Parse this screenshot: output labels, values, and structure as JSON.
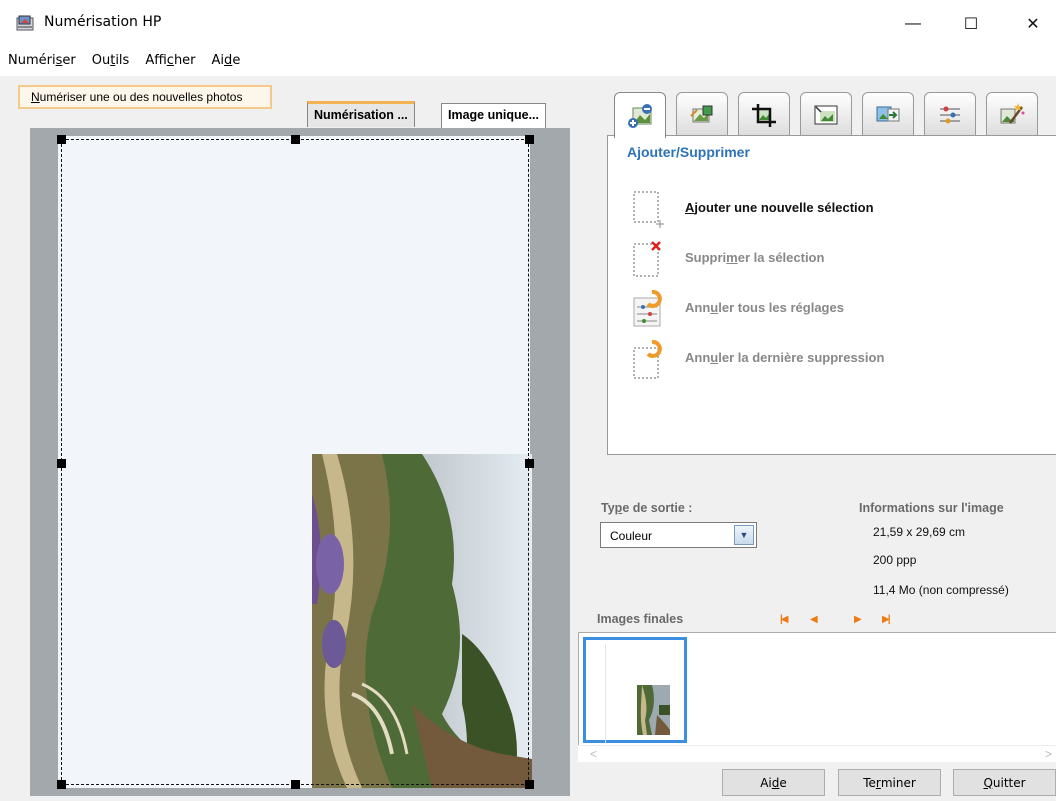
{
  "window": {
    "title": "Numérisation HP",
    "controls": {
      "minimize": "—",
      "maximize": "☐",
      "close": "✕"
    }
  },
  "menu": {
    "items": [
      {
        "pre": "Numéri",
        "key": "s",
        "post": "er"
      },
      {
        "pre": "Ou",
        "key": "t",
        "post": "ils"
      },
      {
        "pre": "Affi",
        "key": "c",
        "post": "her"
      },
      {
        "pre": "Ai",
        "key": "d",
        "post": "e"
      }
    ]
  },
  "left": {
    "scan_button": {
      "key": "N",
      "rest": "umériser une ou des nouvelles photos"
    },
    "tabs": [
      {
        "label": "Numérisation ...",
        "active": true
      },
      {
        "label": "Image unique...",
        "active": false
      }
    ]
  },
  "toolbar": {
    "tabs": [
      "add-remove-icon",
      "color-adjust-icon",
      "crop-icon",
      "resize-icon",
      "destination-icon",
      "settings-icon",
      "enhance-icon"
    ],
    "active_index": 0
  },
  "actions": {
    "title": "Ajouter/Supprimer",
    "items": [
      {
        "pre": "",
        "key": "A",
        "post": "jouter une nouvelle sélection",
        "enabled": true
      },
      {
        "pre": "Suppri",
        "key": "m",
        "post": "er la sélection",
        "enabled": false
      },
      {
        "pre": "Ann",
        "key": "u",
        "post": "ler tous les réglages",
        "enabled": false
      },
      {
        "pre": "Ann",
        "key": "u",
        "post": "ler la dernière suppression",
        "enabled": false
      }
    ]
  },
  "output": {
    "label_pre": "Ty",
    "label_key": "p",
    "label_post": "e de sortie :",
    "selected": "Couleur"
  },
  "info": {
    "title": "Informations sur l'image",
    "dimensions": "21,59 x 29,69 cm",
    "resolution": "200 ppp",
    "size": "11,4 Mo (non compressé)"
  },
  "finals": {
    "title": "Images finales",
    "nav": [
      "first-icon",
      "prev-icon",
      "next-icon",
      "last-icon"
    ]
  },
  "buttons": [
    {
      "pre": "Ai",
      "key": "d",
      "post": "e"
    },
    {
      "pre": "Te",
      "key": "r",
      "post": "miner"
    },
    {
      "pre": "",
      "key": "Q",
      "post": "uitter"
    }
  ],
  "colors": {
    "accent_orange": "#f07a12",
    "title_blue": "#2e73b8",
    "selection_blue": "#3c8ee0"
  }
}
